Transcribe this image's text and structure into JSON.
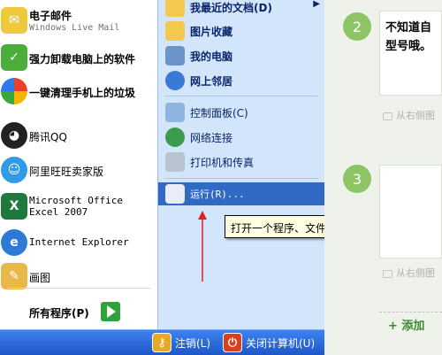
{
  "pinned_programs": [
    {
      "label": "电子邮件",
      "sublabel": "Windows Live Mail",
      "icon": "email-icon"
    },
    {
      "label": "强力卸载电脑上的软件",
      "icon": "uninstall-icon"
    },
    {
      "label": "一键清理手机上的垃圾",
      "icon": "phone-cleaner-icon"
    },
    {
      "label": "腾讯QQ",
      "icon": "qq-icon"
    },
    {
      "label": "阿里旺旺卖家版",
      "icon": "aliwangwang-icon"
    },
    {
      "label": "Microsoft Office Excel 2007",
      "icon": "excel-icon"
    },
    {
      "label": "Internet Explorer",
      "icon": "ie-icon"
    },
    {
      "label": "画图",
      "icon": "paint-icon"
    }
  ],
  "all_programs_label": "所有程序(P)",
  "places": [
    {
      "label": "我最近的文档(D)",
      "icon": "recent-documents-icon",
      "submenu": true
    },
    {
      "label": "图片收藏",
      "icon": "pictures-folder-icon"
    },
    {
      "label": "我的电脑",
      "icon": "my-computer-icon"
    },
    {
      "label": "网上邻居",
      "icon": "network-places-icon"
    }
  ],
  "system_items": [
    {
      "label": "控制面板(C)",
      "icon": "control-panel-icon"
    },
    {
      "label": "网络连接",
      "icon": "network-connections-icon"
    },
    {
      "label": "打印机和传真",
      "icon": "printer-icon"
    }
  ],
  "run_item": {
    "label": "运行(R)...",
    "icon": "run-icon"
  },
  "bottom_bar": {
    "logoff_label": "注销(L)",
    "shutdown_label": "关闭计算机(U)"
  },
  "tooltip_text": "打开一个程序、文件夹、文档或网站。",
  "article": {
    "steps": [
      {
        "number": "2",
        "text_lines": [
          "不知道自",
          "型号哦。"
        ],
        "source_label": "从右侧图"
      },
      {
        "number": "3",
        "source_label": "从右侧图"
      }
    ],
    "add_label": "+ 添加"
  },
  "colors": {
    "menu_blue": "#1e56c7",
    "places_bg": "#d3e5fa",
    "highlight": "#316ac5",
    "tooltip_bg": "#ffffe1",
    "step_green": "#8cc466",
    "arrow_red": "#e02020"
  }
}
